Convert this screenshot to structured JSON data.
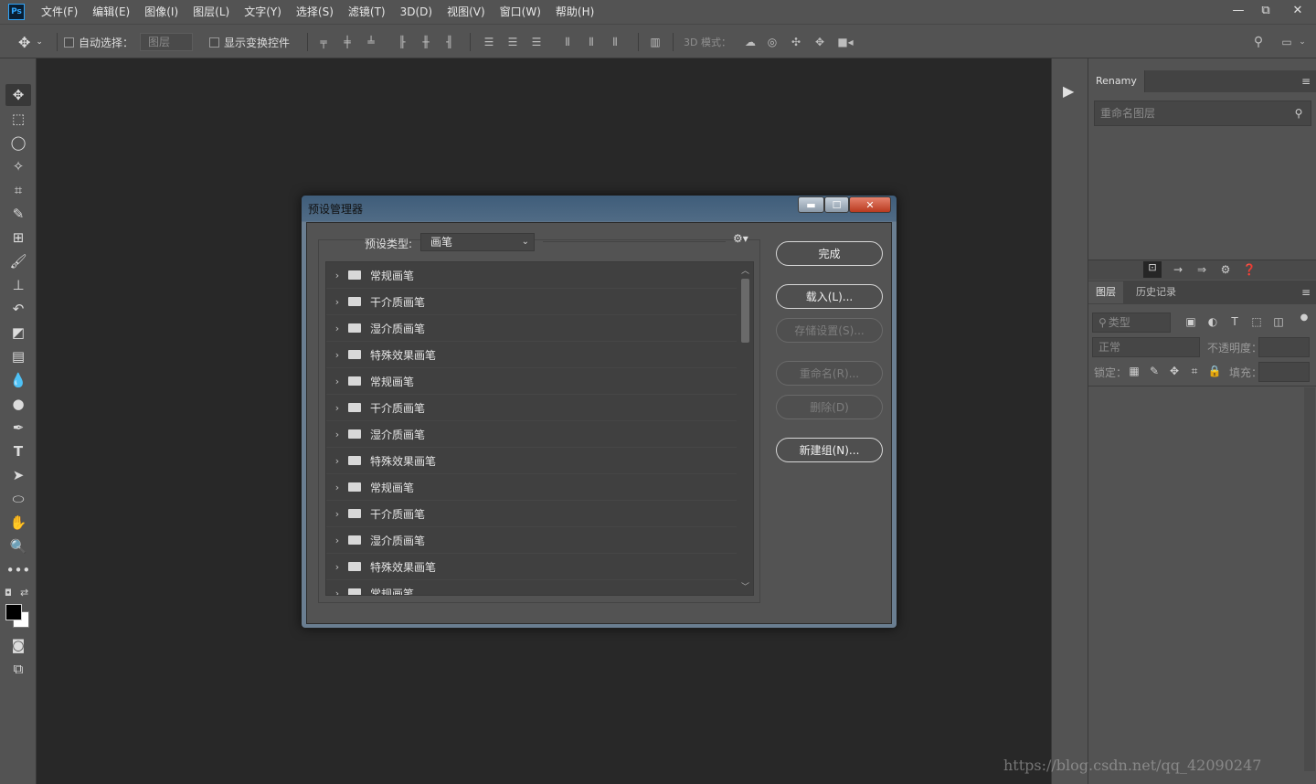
{
  "app": {
    "logo": "Ps"
  },
  "menu": [
    "文件(F)",
    "编辑(E)",
    "图像(I)",
    "图层(L)",
    "文字(Y)",
    "选择(S)",
    "滤镜(T)",
    "3D(D)",
    "视图(V)",
    "窗口(W)",
    "帮助(H)"
  ],
  "window_controls": {
    "minimize": "—",
    "restore": "⧉",
    "close": "✕"
  },
  "options": {
    "auto_select_label": "自动选择：",
    "auto_select_value": "图层",
    "show_transform_label": "显示变换控件",
    "mode_3d_label": "3D 模式："
  },
  "right_panel": {
    "renamy_tab": "Renamy",
    "rename_placeholder": "重命名图层",
    "layers_tab": "图层",
    "history_tab": "历史记录",
    "kind_placeholder": "类型",
    "blend_mode": "正常",
    "opacity_label": "不透明度：",
    "lock_label": "锁定：",
    "fill_label": "填充："
  },
  "dialog": {
    "title": "预设管理器",
    "preset_type_label": "预设类型:",
    "preset_type_value": "画笔",
    "items": [
      "常规画笔",
      "干介质画笔",
      "湿介质画笔",
      "特殊效果画笔",
      "常规画笔",
      "干介质画笔",
      "湿介质画笔",
      "特殊效果画笔",
      "常规画笔",
      "干介质画笔",
      "湿介质画笔",
      "特殊效果画笔",
      "常规画笔"
    ],
    "buttons": {
      "done": "完成",
      "load": "载入(L)...",
      "save": "存储设置(S)...",
      "rename": "重命名(R)...",
      "delete": "删除(D)",
      "new_group": "新建组(N)..."
    }
  },
  "watermark": "https://blog.csdn.net/qq_42090247"
}
